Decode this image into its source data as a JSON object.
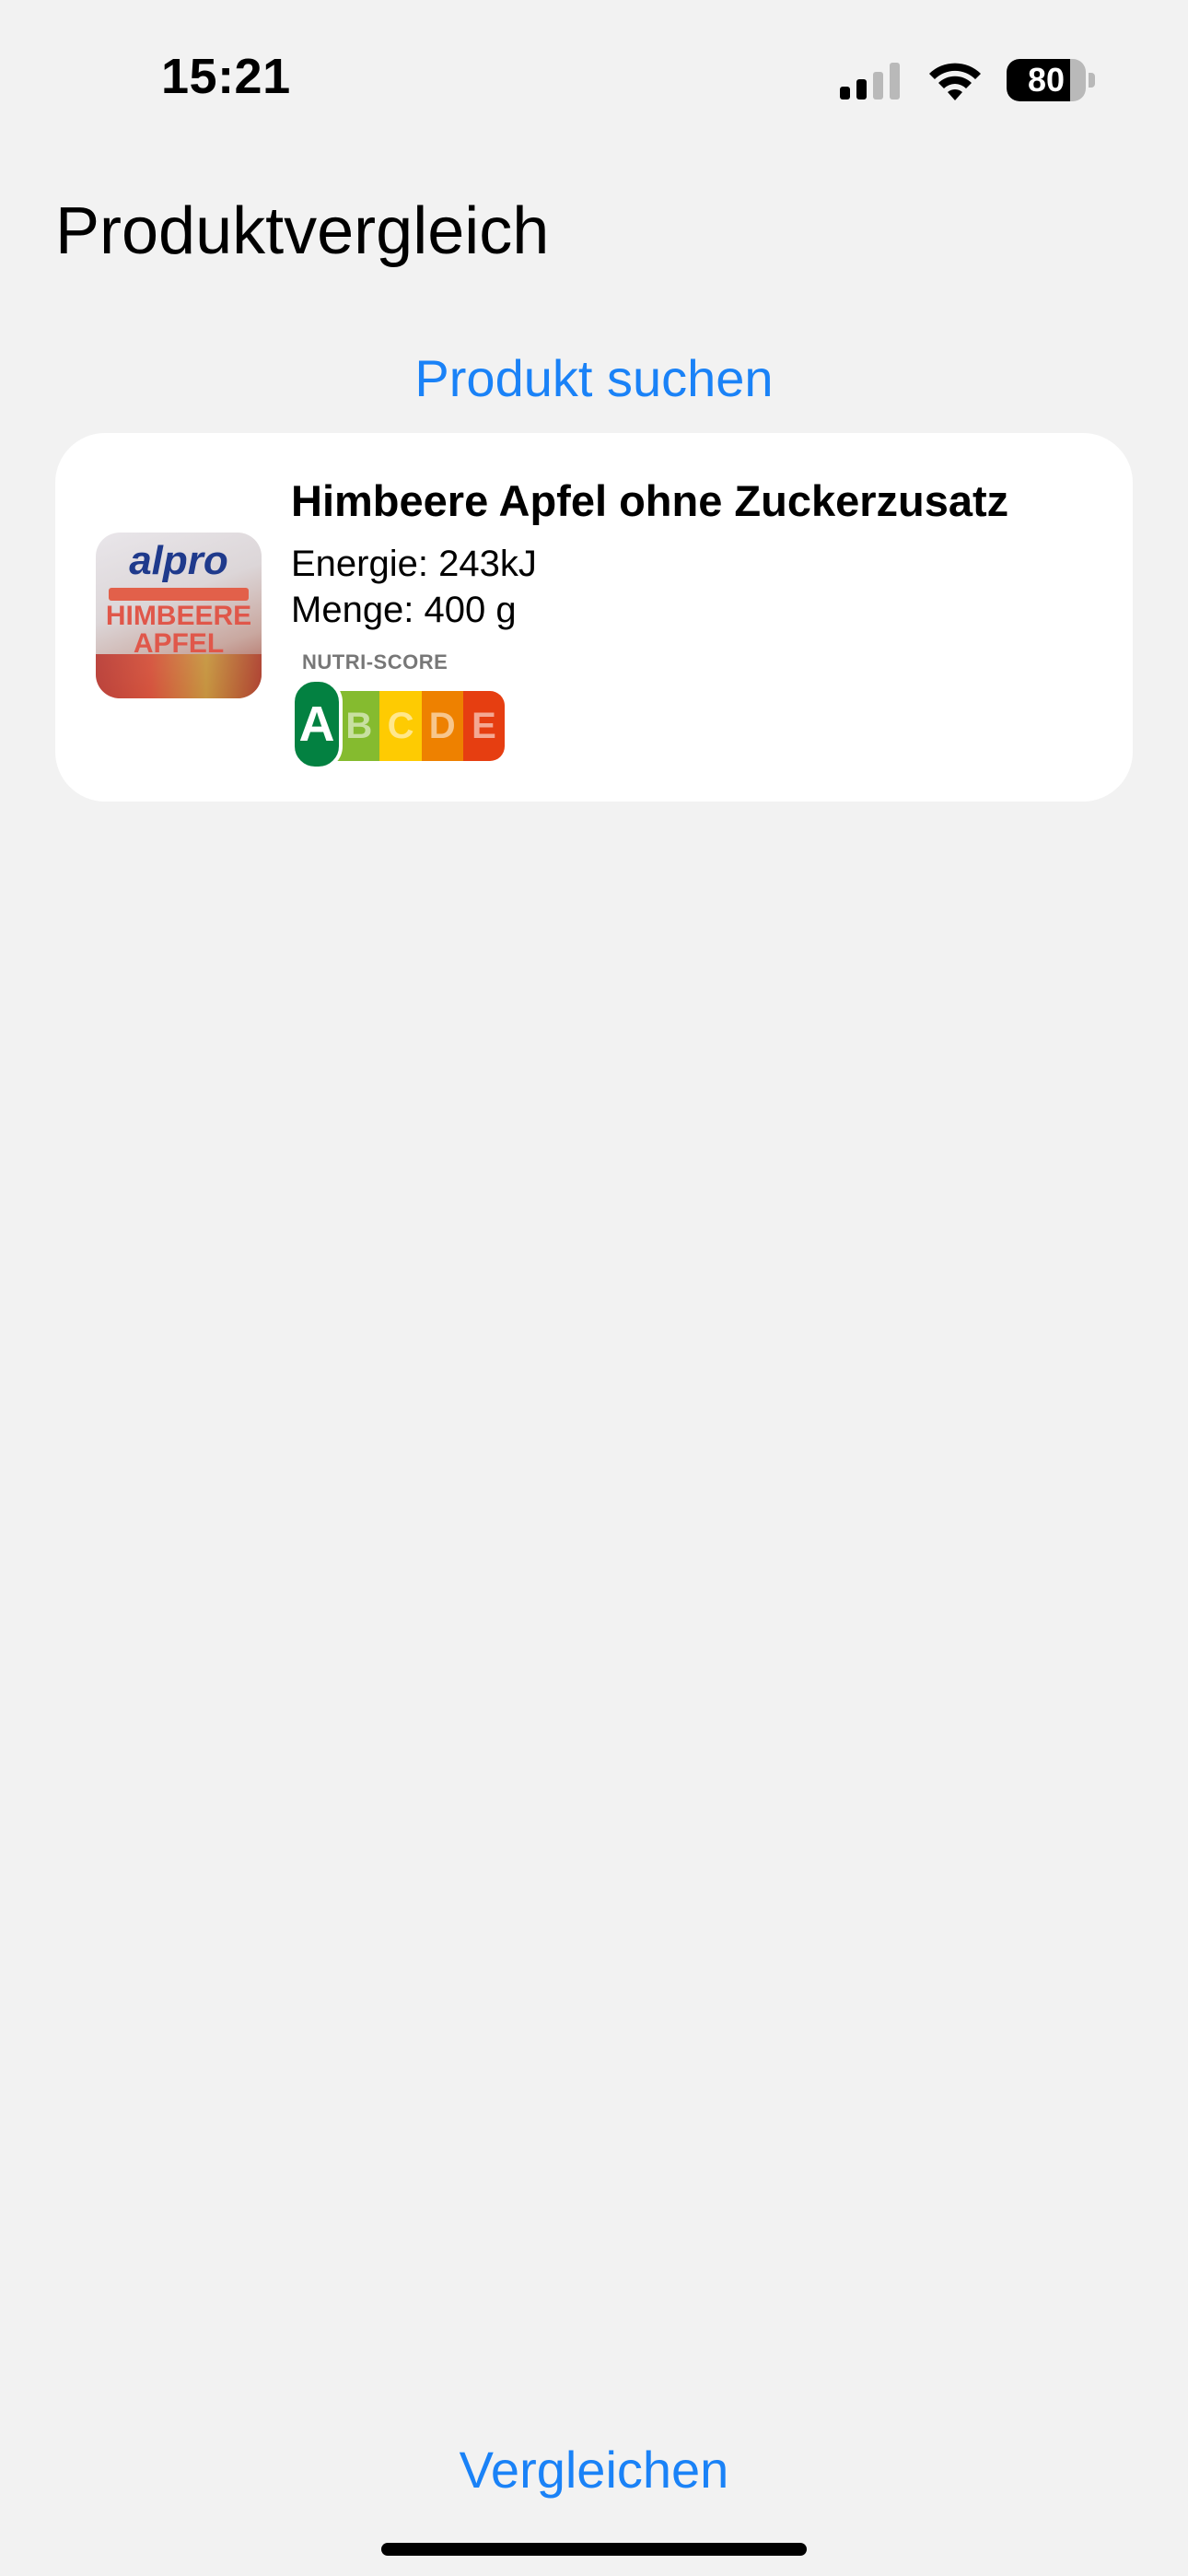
{
  "status_bar": {
    "time": "15:21",
    "battery_level": "80",
    "signal_bars_active": 2,
    "signal_bars_total": 4,
    "icons": [
      "cellular-signal-icon",
      "wifi-icon",
      "battery-icon"
    ]
  },
  "header": {
    "title": "Produktvergleich"
  },
  "search": {
    "label": "Produkt suchen"
  },
  "products": [
    {
      "name": "Himbeere Apfel ohne Zuckerzusatz",
      "energy": "Energie: 243kJ",
      "amount": "Menge: 400 g",
      "image_text": {
        "brand": "alpro",
        "line1": "HIMBEERE",
        "line2": "APFEL"
      },
      "nutri_score": {
        "label": "NUTRI-SCORE",
        "grades": [
          "A",
          "B",
          "C",
          "D",
          "E"
        ],
        "active": "A",
        "colors": {
          "A": "#038141",
          "B": "#85bb2f",
          "C": "#fecb02",
          "D": "#ee8100",
          "E": "#e63e11"
        }
      }
    }
  ],
  "footer": {
    "compare_label": "Vergleichen"
  },
  "theme": {
    "accent": "#1a82f7",
    "background": "#f2f2f2",
    "card": "#ffffff"
  }
}
